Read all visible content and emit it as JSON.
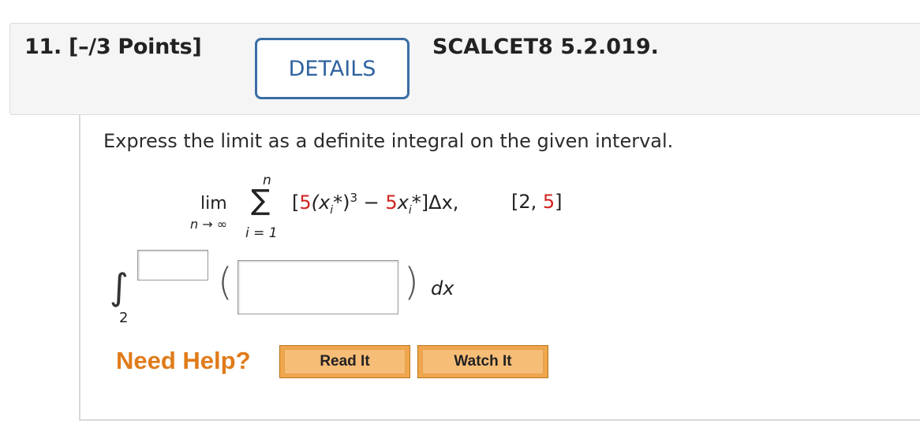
{
  "question": {
    "number_label": "11. [–/3 Points]",
    "details_label": "DETAILS",
    "reference": "SCALCET8 5.2.019."
  },
  "problem": {
    "prompt": "Express the limit as a definite integral on the given interval.",
    "lim": "lim",
    "lim_sub": "n → ∞",
    "sigma": "∑",
    "sigma_top": "n",
    "sigma_bottom": "i = 1",
    "summand": {
      "open": "[",
      "coef1": "5",
      "part1": "(x",
      "sub1": "i",
      "part1b": "*)",
      "exp": "3",
      "minus": " − ",
      "coef2": "5",
      "part2": "x",
      "sub2": "i",
      "part2b": "*]Δx,"
    },
    "interval": {
      "open": "[2, ",
      "upper": "5",
      "close": "]"
    }
  },
  "answer": {
    "integral_sign": "∫",
    "lower_limit": "2",
    "upper_limit_value": "",
    "integrand_value": "",
    "left_paren": "(",
    "right_paren": ")",
    "dx": "dx"
  },
  "help": {
    "label": "Need Help?",
    "read_button": "Read It",
    "watch_button": "Watch It"
  },
  "colors": {
    "accent_blue": "#2f63a0",
    "highlight_red": "#d0231f",
    "help_orange": "#e07b1a",
    "button_orange": "#f0a64c"
  }
}
